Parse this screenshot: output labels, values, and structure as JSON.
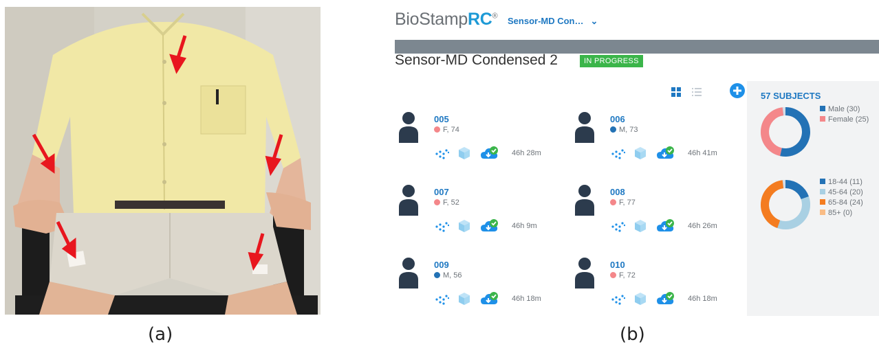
{
  "captions": {
    "a": "(a)",
    "b": "(b)"
  },
  "app": {
    "brand_plain": "BioStamp",
    "brand_bold": "RC",
    "brand_mark": "®",
    "project_selector": "Sensor-MD Con…",
    "study_title": "Sensor-MD Condensed 2",
    "status_badge": "IN PROGRESS",
    "subjects_header": "57 SUBJECTS"
  },
  "subjects": [
    {
      "id": "005",
      "demo": "F, 74",
      "sex": "F",
      "duration": "46h 28m"
    },
    {
      "id": "006",
      "demo": "M, 73",
      "sex": "M",
      "duration": "46h 41m"
    },
    {
      "id": "007",
      "demo": "F, 52",
      "sex": "F",
      "duration": "46h 9m"
    },
    {
      "id": "008",
      "demo": "F, 77",
      "sex": "F",
      "duration": "46h 26m"
    },
    {
      "id": "009",
      "demo": "M, 56",
      "sex": "M",
      "duration": "46h 18m"
    },
    {
      "id": "010",
      "demo": "F, 72",
      "sex": "F",
      "duration": "46h 18m"
    }
  ],
  "chart_data": [
    {
      "type": "pie",
      "categories": [
        "Male",
        "Female"
      ],
      "values": [
        30,
        25
      ],
      "legend": [
        "Male (30)",
        "Female (25)"
      ],
      "colors": [
        "#2372b5",
        "#f4878a"
      ],
      "remainder_color": "#d3dde6"
    },
    {
      "type": "pie",
      "categories": [
        "18-44",
        "45-64",
        "65-84",
        "85+"
      ],
      "values": [
        11,
        20,
        24,
        0
      ],
      "legend": [
        "18-44 (11)",
        "45-64 (20)",
        "65-84 (24)",
        "85+ (0)"
      ],
      "colors": [
        "#2372b5",
        "#a9d0e3",
        "#f47c20",
        "#f9bc86"
      ],
      "remainder_color": "#d3dde6"
    }
  ],
  "colors": {
    "accent": "#1e78c2",
    "badge": "#3bb54a",
    "female_dot": "#f4878a",
    "male_dot": "#2372b5"
  }
}
